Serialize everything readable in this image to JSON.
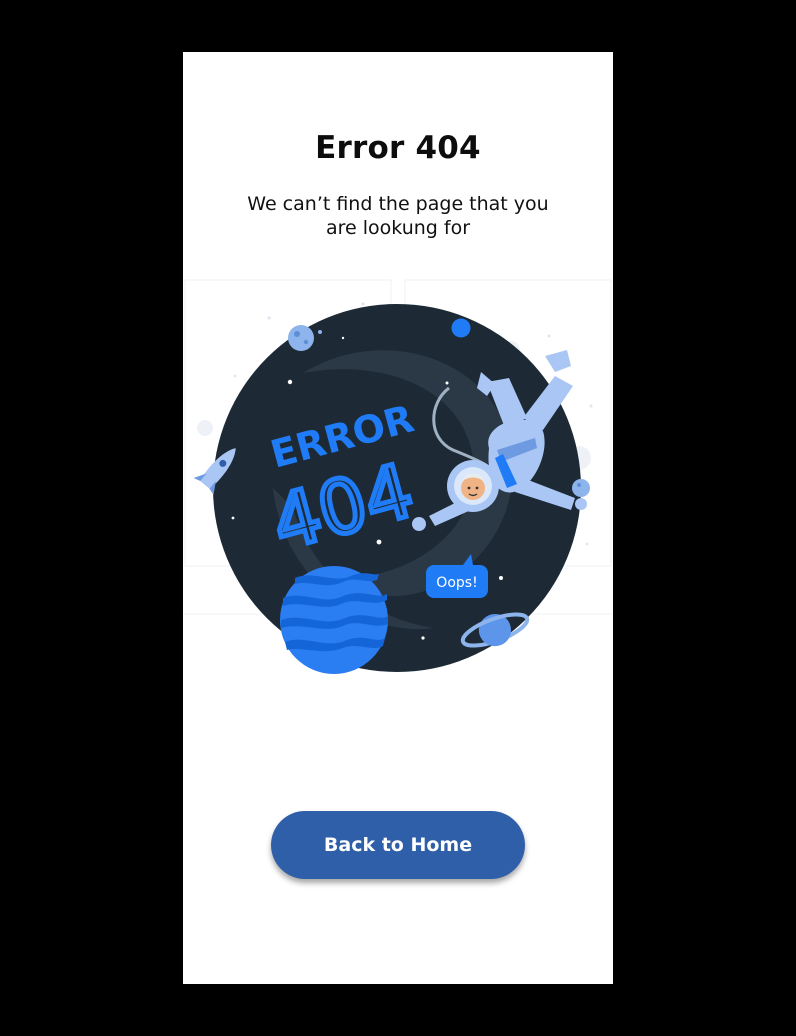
{
  "page": {
    "title": "Error 404",
    "subtitle": "We can’t find the page that you are lookung for"
  },
  "illustration": {
    "headline_word": "ERROR",
    "headline_number": "404",
    "speech_bubble": "Oops!",
    "icons": [
      "planet-icon",
      "rocket-icon",
      "astronaut-icon",
      "ringed-planet-icon",
      "star-icon"
    ]
  },
  "actions": {
    "back_home_label": "Back to Home"
  },
  "colors": {
    "accent": "#2f5fa8",
    "bright_blue": "#1f7cf6",
    "space_dark": "#1d2a35",
    "suit_light": "#a9c6f5"
  }
}
